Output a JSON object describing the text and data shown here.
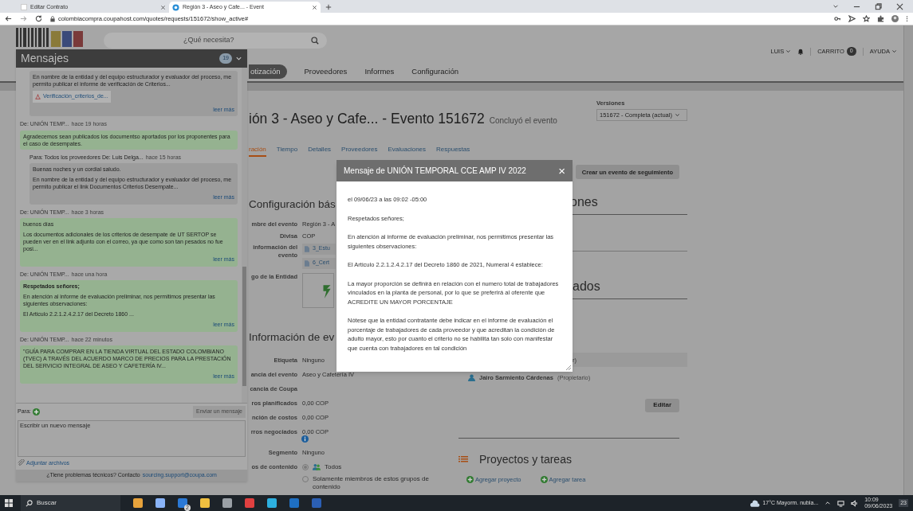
{
  "browser": {
    "tabs": [
      {
        "title": "Editar Contrato",
        "selected": false
      },
      {
        "title": "Región 3 - Aseo y Cafe... - Event",
        "selected": true
      }
    ],
    "url": "colombiacompra.coupahost.com/quotes/requests/151672/show_active#"
  },
  "header": {
    "search_placeholder": "¿Qué necesita?",
    "user": "LUIS",
    "cart_label": "CARRITO",
    "cart_count": "0",
    "help": "AYUDA"
  },
  "nav": [
    {
      "label": "otización",
      "selected": true
    },
    {
      "label": "Proveedores",
      "selected": false
    },
    {
      "label": "Informes",
      "selected": false
    },
    {
      "label": "Configuración",
      "selected": false
    }
  ],
  "event": {
    "title": "ión 3 - Aseo y Cafe... - Evento 151672",
    "status": "Concluyó el evento",
    "versions_label": "Versiones",
    "version": "151672 - Completa (actual)",
    "subtabs": [
      {
        "label": "ración",
        "selected": true
      },
      {
        "label": "Tiempo",
        "selected": false
      },
      {
        "label": "Detalles",
        "selected": false
      },
      {
        "label": "Proveedores",
        "selected": false
      },
      {
        "label": "Evaluaciones",
        "selected": false
      },
      {
        "label": "Respuestas",
        "selected": false
      }
    ],
    "follow_up_button": "Crear un evento de seguimiento",
    "basic": {
      "title": "Configuración bás",
      "fields": [
        {
          "label": "mbre del evento",
          "value": "Región 3 - A"
        },
        {
          "label": "Divisa",
          "value": "COP"
        }
      ],
      "files_label": "información del evento",
      "files": [
        "3_Estu",
        "6_Cert"
      ],
      "logo_label": "go de la Entidad"
    },
    "info": {
      "title": "Información de ev",
      "fields": [
        {
          "label": "Etiqueta",
          "value": "Ninguno"
        },
        {
          "label": "ancia del evento",
          "value": "Aseo y Cafetería IV"
        },
        {
          "label": "cancia de Coupa"
        },
        {
          "label": "ros planificados",
          "value": "0,00 COP"
        },
        {
          "label": "nción de costos",
          "value": "0,00 COP"
        },
        {
          "label": "rros negociados",
          "value": "0,00 COP"
        },
        {
          "label": "Segmento",
          "value": "Ninguno"
        }
      ],
      "content_label": "os de contenido",
      "content_options": [
        {
          "label": "Todos",
          "selected": true
        },
        {
          "label": "Solamente miembros de estos grupos de contenido",
          "selected": false
        }
      ]
    },
    "right": {
      "section_1": "ones",
      "section_2": "ados",
      "table_header": "r)",
      "owner_name": "Jairo Sarmiento Cárdenas",
      "owner_role": "(Propietario)",
      "edit_button": "Editar",
      "projects_title": "Proyectos y tareas",
      "add_project": "Agregar proyecto",
      "add_task": "Agregar tarea"
    }
  },
  "messages": {
    "title": "Mensajes",
    "count": "19",
    "items": [
      {
        "kind": "outgoing",
        "paragraphs": [
          "En nombre de la entidad y del equipo estructurador y evaluador del proceso, me permito publicar el informe de verificación de Criterios..."
        ],
        "attachment": "Verificación_criterios_de...",
        "read_more": "leer más"
      },
      {
        "kind": "incoming",
        "from": "De: UNIÓN TEMP...",
        "time": "hace 19 horas",
        "paragraphs": [
          "Agradecemos sean publicados los documentso aportados por los proponentes para el caso de desempates."
        ]
      },
      {
        "kind": "outgoing",
        "from": "Para: Todos los proveedores De: Luis Delga...",
        "time": "hace 15 horas",
        "paragraphs": [
          "Buenas noches y un cordial saludo.",
          "En nombre de la entidad y del equipo estructurador y evaluador del proceso, me permito publicar el link Documentos Criterios Desempate..."
        ],
        "read_more": "leer más"
      },
      {
        "kind": "incoming",
        "from": "De: UNIÓN TEMP...",
        "time": "hace 3 horas",
        "paragraphs": [
          "buenos días",
          "Los documentos adicionales de los criterios de desempate de UT SERTOP se pueden ver en el link adjunto con el correo, ya que como son tan pesados no fue posi..."
        ],
        "read_more": "leer más"
      },
      {
        "kind": "incoming",
        "from": "De: UNIÓN TEMP...",
        "time": "hace una hora",
        "paragraphs": [
          "**Respetados señores;**",
          "En atención al informe de evaluación preliminar, nos permitimos presentar las siguientes observaciones:",
          "El Articulo 2.2.1.2.4.2.17 del Decreto 1860 ..."
        ],
        "read_more": "leer más"
      },
      {
        "kind": "incoming",
        "from": "De: UNIÓN TEMP...",
        "time": "hace 22 minutos",
        "paragraphs": [
          "\"GUÍA PARA COMPRAR EN LA TIENDA VIRTUAL DEL ESTADO COLOMBIANO (TVEC) A TRAVÉS DEL ACUERDO MARCO DE PRECIOS PARA LA PRESTACIÓN DEL SERVICIO INTEGRAL DE ASEO Y CAFETERÍA IV..."
        ],
        "read_more": "leer más"
      }
    ],
    "to_label": "Para:",
    "send_button": "Enviar un mensaje",
    "compose_placeholder": "Escribir un nuevo mensaje",
    "attach": "Adjuntar archivos",
    "support_text": "¿Tiene problemas técnicos? Contacto",
    "support_link": "sourcing.support@coupa.com"
  },
  "modal": {
    "title": "Mensaje de UNIÓN TEMPORAL CCE AMP IV 2022",
    "close": "×",
    "paragraphs": [
      "el 09/06/23 a las 09:02 -05:00",
      "Respetados señores;",
      "En atención al informe de evaluación preliminar, nos permitimos presentar las siguientes observaciones:",
      "El Articulo 2.2.1.2.4.2.17 del Decreto 1860 de 2021, Numeral 4 establece:",
      "La mayor proporción se definirá en relación con el numero total de trabajadores vinculados en la planta de personal, por lo que se preferirá al oferente que ACREDITE UN MAYOR PORCENTAJE",
      "Nótese que la entidad contratante debe indicar en el informe de evaluación el porcentaje de trabajadores de cada proveedor y que acreditan la condición de adulto mayor, esto por cuanto el criterio no se habilita tan solo con manifestar que cuenta con trabajadores en tal condición"
    ]
  },
  "taskbar": {
    "search": "Buscar",
    "mail_badge": "2",
    "weather": "17°C Mayorm. nubla...",
    "time": "10:09",
    "date": "09/06/2023",
    "notifications": "23"
  }
}
